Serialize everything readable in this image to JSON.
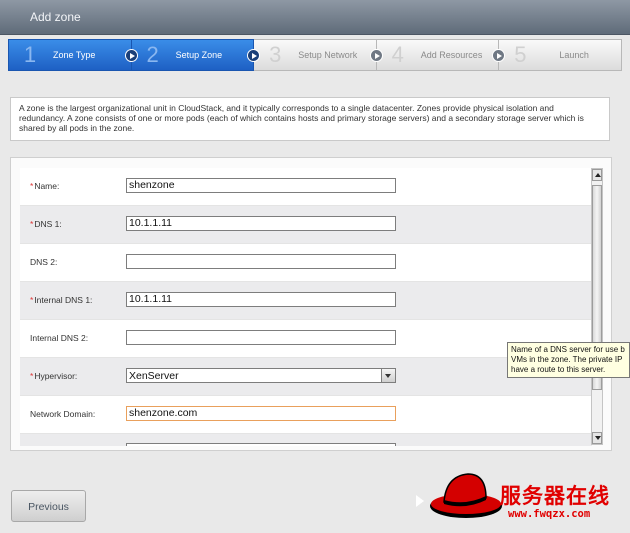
{
  "window": {
    "title": "Add zone"
  },
  "steps": [
    {
      "num": "1",
      "label": "Zone Type",
      "active": true
    },
    {
      "num": "2",
      "label": "Setup Zone",
      "active": true
    },
    {
      "num": "3",
      "label": "Setup Network",
      "active": false
    },
    {
      "num": "4",
      "label": "Add Resources",
      "active": false
    },
    {
      "num": "5",
      "label": "Launch",
      "active": false
    }
  ],
  "description": "A zone is the largest organizational unit in CloudStack, and it typically corresponds to a single datacenter. Zones provide physical isolation and redundancy. A zone consists of one or more pods (each of which contains hosts and primary storage servers) and a secondary storage server which is shared by all pods in the zone.",
  "form": {
    "name": {
      "label": "Name:",
      "required": "*",
      "value": "shenzone"
    },
    "dns1": {
      "label": "DNS 1:",
      "required": "*",
      "value": "10.1.1.11"
    },
    "dns2": {
      "label": "DNS 2:",
      "value": ""
    },
    "internal_dns1": {
      "label": "Internal DNS 1:",
      "required": "*",
      "value": "10.1.1.11"
    },
    "internal_dns2": {
      "label": "Internal DNS 2:",
      "value": ""
    },
    "hypervisor": {
      "label": "Hypervisor:",
      "required": "*",
      "value": "XenServer"
    },
    "network_domain": {
      "label": "Network Domain:",
      "value": "shenzone.com"
    }
  },
  "tooltip": {
    "line1": "Name of a DNS server for use b",
    "line2": "VMs in the zone. The private IP",
    "line3": "have a route to this server."
  },
  "buttons": {
    "previous": "Previous"
  },
  "watermark": {
    "text": "服务器在线",
    "url": "www.fwqzx.com"
  },
  "colors": {
    "active_step": "#1e60c4",
    "required": "#dd3333",
    "focus_border": "#e9a05c"
  }
}
